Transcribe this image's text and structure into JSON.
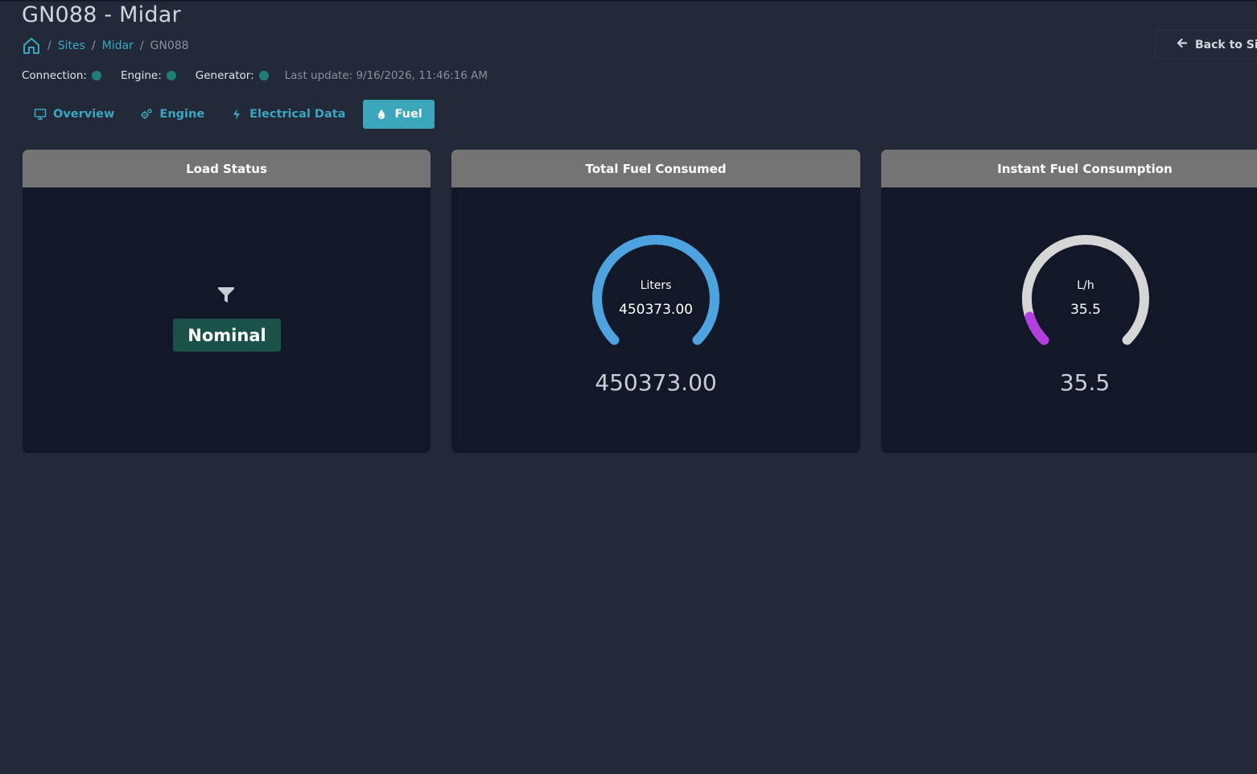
{
  "page": {
    "title": "GN088 - Midar",
    "back_label": "Back to Si"
  },
  "breadcrumb": {
    "items": [
      {
        "label": "Sites"
      },
      {
        "label": "Midar"
      },
      {
        "label": "GN088"
      }
    ],
    "separator": "/"
  },
  "status": {
    "connection_label": "Connection:",
    "engine_label": "Engine:",
    "generator_label": "Generator:",
    "last_update": "Last update: 9/16/2026, 11:46:16 AM",
    "dot_color": "#1e7f78"
  },
  "tabs": [
    {
      "label": "Overview",
      "icon": "monitor-icon",
      "active": false
    },
    {
      "label": "Engine",
      "icon": "gears-icon",
      "active": false
    },
    {
      "label": "Electrical Data",
      "icon": "bolt-icon",
      "active": false
    },
    {
      "label": "Fuel",
      "icon": "droplet-icon",
      "active": true
    }
  ],
  "cards": {
    "load_status": {
      "title": "Load Status",
      "icon": "filter-icon",
      "status": "Nominal",
      "status_color": "#1b5248"
    },
    "total_fuel": {
      "title": "Total Fuel Consumed",
      "unit": "Liters",
      "gauge_value": "450373.00",
      "value": "450373.00",
      "fill_fraction": 1.0,
      "color": "#4da3e0"
    },
    "instant_fuel": {
      "title": "Instant Fuel Consumption",
      "unit": "L/h",
      "gauge_value": "35.5",
      "value": "35.5",
      "fill_fraction": 0.1,
      "color": "#b43ee0",
      "track_color": "#d6d6d6"
    }
  },
  "colors": {
    "background": "#222a3a",
    "card_background": "#121828",
    "card_header": "#747474",
    "accent": "#3aa6c0",
    "active_tab": "#3ca7bb"
  }
}
